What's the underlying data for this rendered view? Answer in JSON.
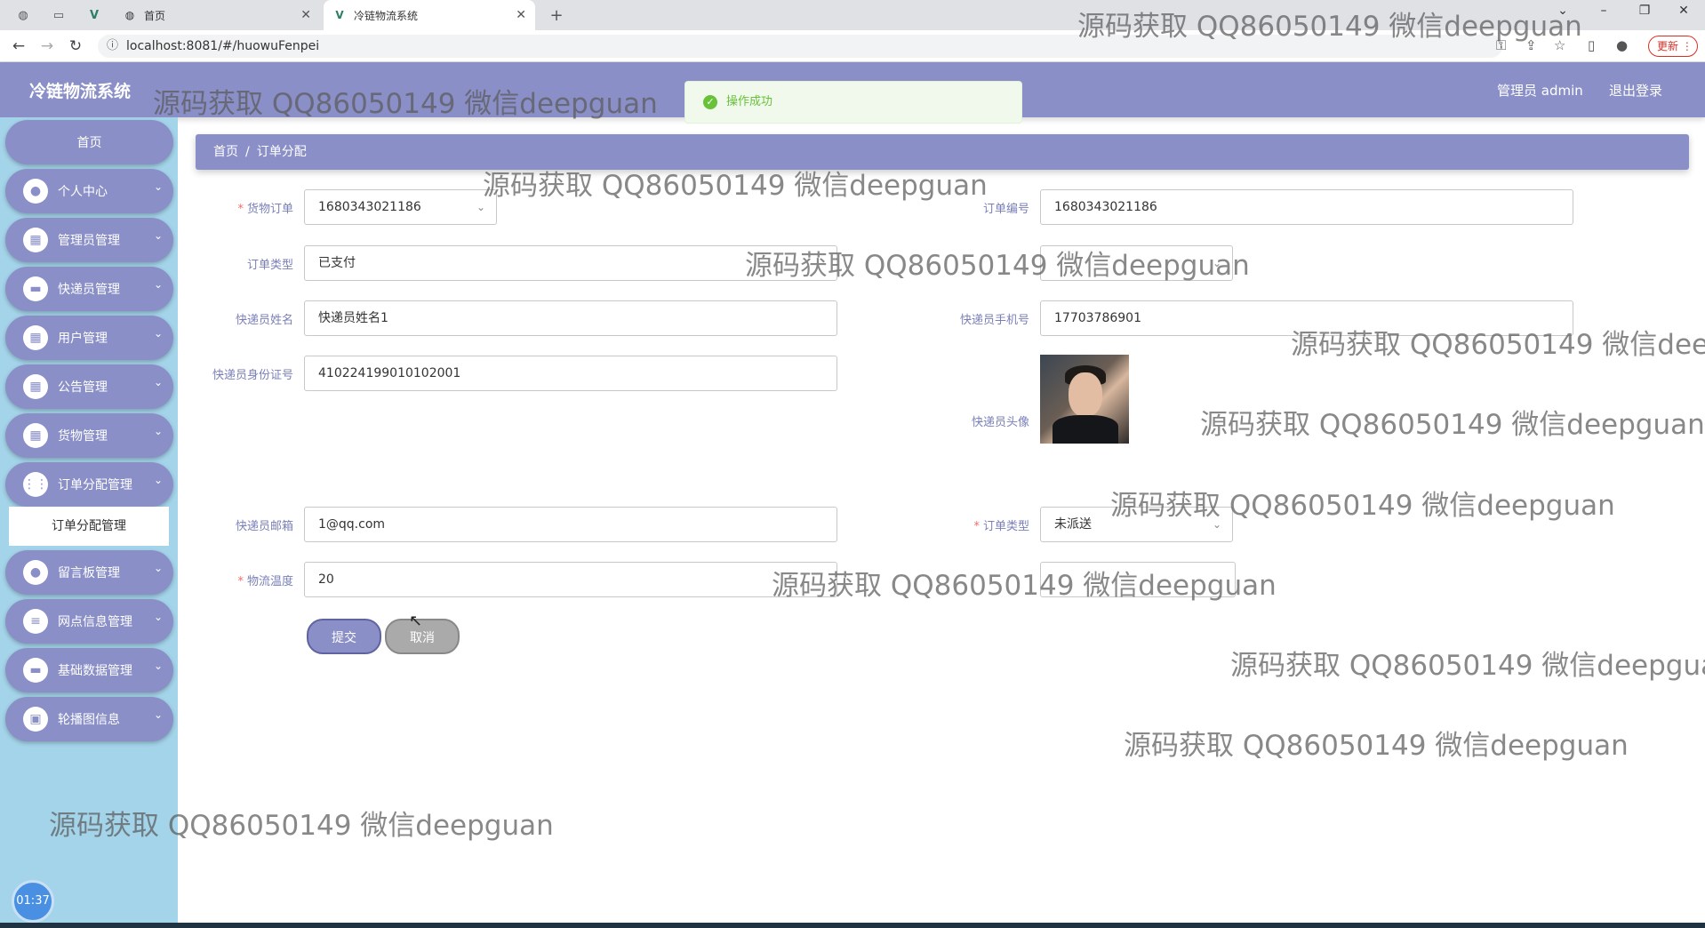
{
  "browser": {
    "tabs": [
      {
        "label": "首页",
        "active": false
      },
      {
        "label": "冷链物流系统",
        "active": true
      }
    ],
    "url": "localhost:8081/#/huowuFenpei",
    "update_label": "更新"
  },
  "header": {
    "title": "冷链物流系统",
    "user": "管理员 admin",
    "logout": "退出登录"
  },
  "toast": {
    "message": "操作成功",
    "type": "success"
  },
  "sidebar": {
    "home": "首页",
    "items": [
      {
        "label": "个人中心",
        "icon": "user-icon"
      },
      {
        "label": "管理员管理",
        "icon": "grid-icon"
      },
      {
        "label": "快递员管理",
        "icon": "monitor-icon"
      },
      {
        "label": "用户管理",
        "icon": "grid-icon"
      },
      {
        "label": "公告管理",
        "icon": "grid-icon"
      },
      {
        "label": "货物管理",
        "icon": "grid-icon"
      },
      {
        "label": "订单分配管理",
        "icon": "apps-icon"
      },
      {
        "label": "留言板管理",
        "icon": "user-icon"
      },
      {
        "label": "网点信息管理",
        "icon": "sliders-icon"
      },
      {
        "label": "基础数据管理",
        "icon": "monitor-icon"
      },
      {
        "label": "轮播图信息",
        "icon": "briefcase-icon"
      }
    ],
    "submenu_active": "订单分配管理",
    "timer": "01:37"
  },
  "breadcrumb": {
    "home": "首页",
    "separator": "/",
    "current": "订单分配"
  },
  "form": {
    "goods_order": {
      "label": "货物订单",
      "value": "1680343021186",
      "required": true
    },
    "order_no": {
      "label": "订单编号",
      "value": "1680343021186"
    },
    "order_type": {
      "label": "订单类型",
      "value": "已支付"
    },
    "courier_name": {
      "label": "快递员姓名",
      "value": "快递员姓名1"
    },
    "courier_phone": {
      "label": "快递员手机号",
      "value": "17703786901"
    },
    "courier_id": {
      "label": "快递员身份证号",
      "value": "410224199010102001"
    },
    "courier_avatar": {
      "label": "快递员头像"
    },
    "courier_email": {
      "label": "快递员邮箱",
      "value": "1@qq.com"
    },
    "dispatch_type": {
      "label": "订单类型",
      "value": "未派送",
      "required": true
    },
    "temperature": {
      "label": "物流温度",
      "value": "20",
      "required": true
    },
    "submit": "提交",
    "cancel": "取消"
  },
  "watermark": "源码获取 QQ86050149 微信deepguan"
}
